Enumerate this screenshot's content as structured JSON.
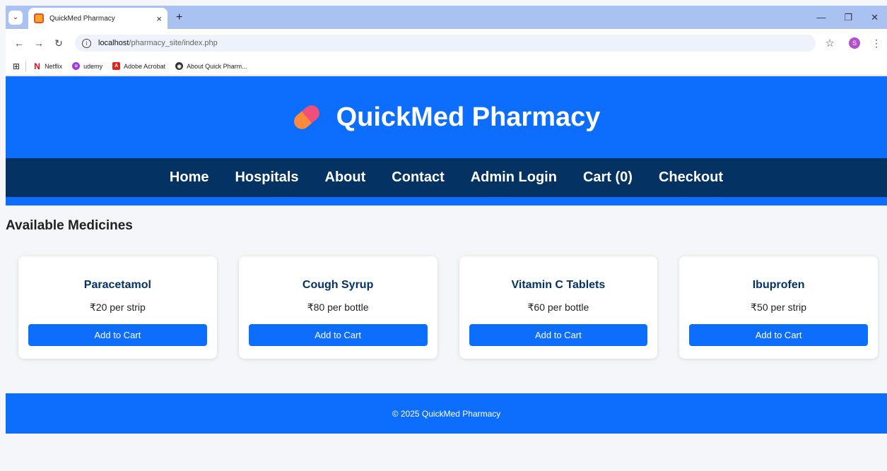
{
  "browser": {
    "tab_title": "QuickMed Pharmacy",
    "url_host": "localhost",
    "url_path": "/pharmacy_site/index.php",
    "profile_initial": "S",
    "bookmarks": [
      {
        "label": "Netflix",
        "icon": "netflix-icon"
      },
      {
        "label": "udemy",
        "icon": "udemy-icon"
      },
      {
        "label": "Adobe Acrobat",
        "icon": "acrobat-icon"
      },
      {
        "label": "About Quick Pharm...",
        "icon": "globe-icon"
      }
    ]
  },
  "header": {
    "title": "QuickMed Pharmacy",
    "logo_icon": "pill-icon",
    "color": "#0d6efd"
  },
  "nav": {
    "items": [
      "Home",
      "Hospitals",
      "About",
      "Contact",
      "Admin Login",
      "Cart (0)",
      "Checkout"
    ],
    "color": "#033263"
  },
  "main": {
    "section_title": "Available Medicines",
    "products": [
      {
        "name": "Paracetamol",
        "price": "₹20 per strip",
        "button": "Add to Cart"
      },
      {
        "name": "Cough Syrup",
        "price": "₹80 per bottle",
        "button": "Add to Cart"
      },
      {
        "name": "Vitamin C Tablets",
        "price": "₹60 per bottle",
        "button": "Add to Cart"
      },
      {
        "name": "Ibuprofen",
        "price": "₹50 per strip",
        "button": "Add to Cart"
      }
    ]
  },
  "footer": {
    "text": "© 2025 QuickMed Pharmacy"
  }
}
